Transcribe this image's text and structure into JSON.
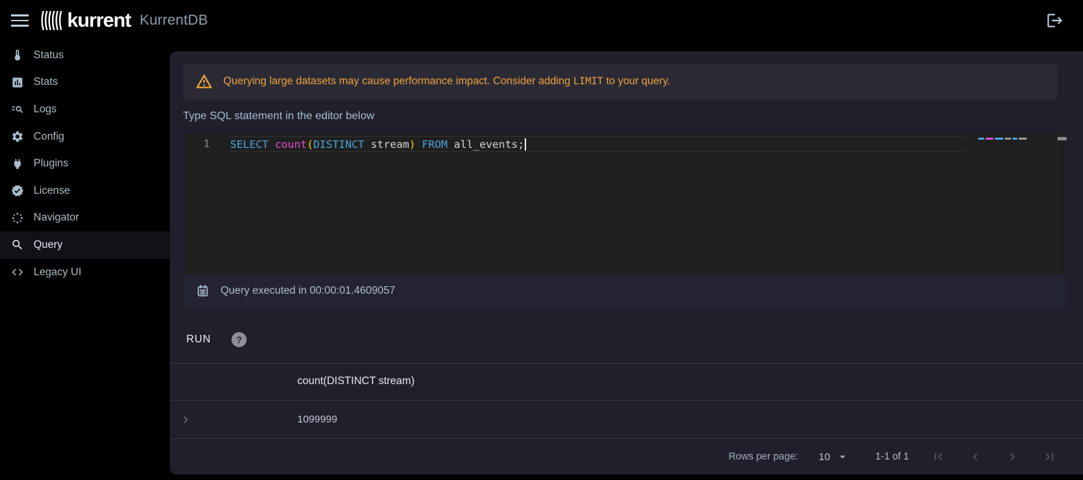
{
  "topbar": {
    "brand": "kurrent",
    "product": "KurrentDB"
  },
  "sidebar": {
    "items": [
      {
        "label": "Status",
        "icon": "thermometer-icon",
        "active": false
      },
      {
        "label": "Stats",
        "icon": "bar-chart-icon",
        "active": false
      },
      {
        "label": "Logs",
        "icon": "log-search-icon",
        "active": false
      },
      {
        "label": "Config",
        "icon": "gear-icon",
        "active": false
      },
      {
        "label": "Plugins",
        "icon": "plug-icon",
        "active": false
      },
      {
        "label": "License",
        "icon": "verified-badge-icon",
        "active": false
      },
      {
        "label": "Navigator",
        "icon": "navigator-dots-icon",
        "active": false
      },
      {
        "label": "Query",
        "icon": "search-icon",
        "active": true
      },
      {
        "label": "Legacy UI",
        "icon": "code-brackets-icon",
        "active": false
      }
    ]
  },
  "query_page": {
    "warning": {
      "before": "Querying large datasets may cause performance impact. Consider adding ",
      "code": "LIMIT",
      "after": " to your query."
    },
    "editor_hint": "Type SQL statement in the editor below",
    "editor": {
      "line_number": "1",
      "tokens": [
        {
          "text": "SELECT ",
          "color": "#4ba3dd"
        },
        {
          "text": "count",
          "color": "#e44fd4"
        },
        {
          "text": "(",
          "color": "#ffd602"
        },
        {
          "text": "DISTINCT",
          "color": "#4ba3dd"
        },
        {
          "text": " stream",
          "color": "#d4d4d4"
        },
        {
          "text": ")",
          "color": "#ffd602"
        },
        {
          "text": " FROM ",
          "color": "#4ba3dd"
        },
        {
          "text": "all_events;",
          "color": "#d4d4d4"
        }
      ]
    },
    "execution_status": "Query executed in 00:00:01.4609057",
    "run_button": "RUN",
    "help_glyph": "?",
    "results": {
      "column_header": "count(DISTINCT stream)",
      "rows": [
        {
          "value": "1099999"
        }
      ]
    },
    "pagination": {
      "rows_per_page_label": "Rows per page:",
      "rows_per_page_value": "10",
      "range": "1-1 of 1"
    }
  },
  "colors": {
    "panel_bg": "#211f2c",
    "banner_bg": "#2b2a34",
    "editor_bg": "#1f1f1f",
    "warning_text": "#eba43d",
    "sidebar_text": "#a8bdc8",
    "accent_text": "#a8bfcf"
  }
}
